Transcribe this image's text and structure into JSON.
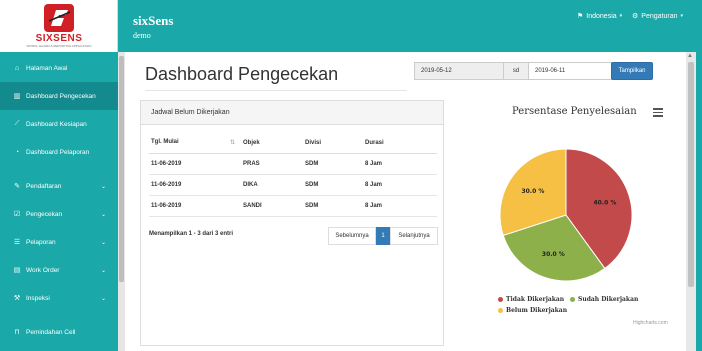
{
  "brand": {
    "logo_text": "SIXSENS",
    "logo_sub": "PATROL GUARD & REPORTING APPLICATION",
    "app_title": "sixSens",
    "app_sub": "demo"
  },
  "top_menu": {
    "language": "Indonesia",
    "settings": "Pengaturan"
  },
  "sidebar": {
    "items": [
      {
        "label": "Halaman Awal",
        "icon": "home-icon"
      },
      {
        "label": "Dashboard Pengecekan",
        "icon": "bar-chart-icon"
      },
      {
        "label": "Dashboard Kesiapan",
        "icon": "line-chart-icon"
      },
      {
        "label": "Dashboard Pelaporan",
        "icon": "dashboard-icon"
      },
      {
        "label": "Pendaftaran",
        "icon": "edit-icon"
      },
      {
        "label": "Pengecekan",
        "icon": "check-icon"
      },
      {
        "label": "Pelaporan",
        "icon": "list-icon"
      },
      {
        "label": "Work Order",
        "icon": "book-icon"
      },
      {
        "label": "Inspeksi",
        "icon": "gavel-icon"
      },
      {
        "label": "Pemindahan Cell",
        "icon": "cell-icon"
      }
    ]
  },
  "main": {
    "title": "Dashboard Pengecekan",
    "date_from": "2019-05-12",
    "date_sep": "sd",
    "date_to": "2019-06-11",
    "show_button": "Tampilkan"
  },
  "panel": {
    "heading": "Jadwal Belum Dikerjakan",
    "columns": [
      "Tgl. Mulai",
      "Objek",
      "Divisi",
      "Durasi"
    ],
    "rows": [
      [
        "11-06-2019",
        "PRAS",
        "SDM",
        "8 Jam"
      ],
      [
        "11-06-2019",
        "DIKA",
        "SDM",
        "8 Jam"
      ],
      [
        "11-06-2019",
        "SANDI",
        "SDM",
        "8 Jam"
      ]
    ],
    "info": "Menampilkan 1 - 3 dari 3 entri",
    "prev": "Sebelumnya",
    "page": "1",
    "next": "Selanjutnya"
  },
  "chart_data": {
    "type": "pie",
    "title": "Persentase Penyelesaian",
    "slices": [
      {
        "name": "Tidak Dikerjakan",
        "value": 40.0,
        "label": "40.0 %",
        "color": "#c24a4a"
      },
      {
        "name": "Sudah Dikerjakan",
        "value": 30.0,
        "label": "30.0 %",
        "color": "#8db04a"
      },
      {
        "name": "Belum Dikerjakan",
        "value": 30.0,
        "label": "30.0 %",
        "color": "#f5c043"
      }
    ],
    "legend_position": "bottom",
    "credits": "Highcharts.com"
  }
}
